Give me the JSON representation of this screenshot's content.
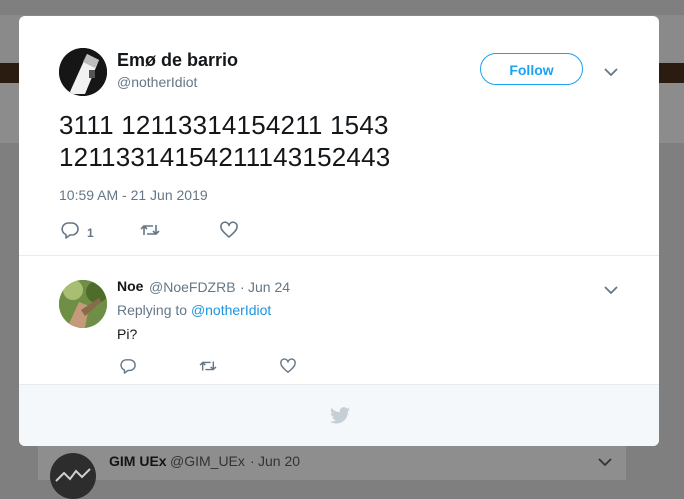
{
  "background": {
    "card": {
      "name": "GIM UEx",
      "handle": "@GIM_UEx",
      "separator": "·",
      "date": "Jun 20"
    }
  },
  "tweet": {
    "author_name": "Emø de barrio",
    "author_handle": "@notherIdiot",
    "follow_label": "Follow",
    "text_lines": [
      "3111 12113314154211 1543",
      "12113314154211143152443"
    ],
    "timestamp": "10:59 AM - 21 Jun 2019",
    "reply_count": "1"
  },
  "reply": {
    "name": "Noe",
    "handle": "@NoeFDZRB",
    "separator": "·",
    "date": "Jun 24",
    "replying_prefix": "Replying to",
    "replying_to": "@notherIdiot",
    "text": "Pi?"
  },
  "colors": {
    "accent": "#1da1f2",
    "muted": "#657786",
    "text": "#14171a",
    "overlay": "#7f7f7f"
  },
  "icons": [
    "reply-icon",
    "retweet-icon",
    "like-icon",
    "chevron-down-icon",
    "twitter-bird-icon"
  ]
}
